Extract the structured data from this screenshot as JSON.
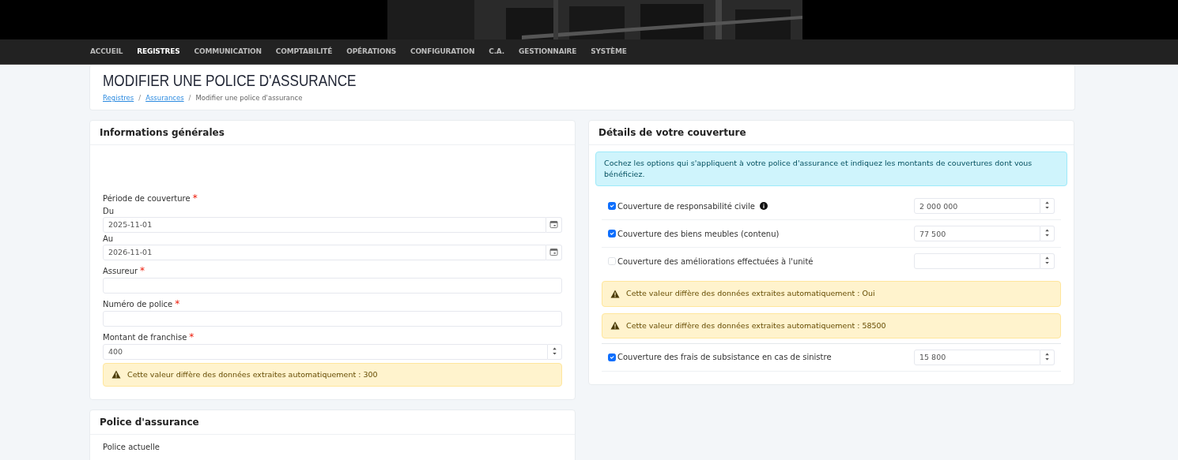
{
  "nav": [
    {
      "label": "ACCUEIL",
      "selected": false
    },
    {
      "label": "REGISTRES",
      "selected": true
    },
    {
      "label": "COMMUNICATION",
      "selected": false
    },
    {
      "label": "COMPTABILITÉ",
      "selected": false
    },
    {
      "label": "OPÉRATIONS",
      "selected": false
    },
    {
      "label": "CONFIGURATION",
      "selected": false
    },
    {
      "label": "C.A.",
      "selected": false
    },
    {
      "label": "GESTIONNAIRE",
      "selected": false
    },
    {
      "label": "SYSTÈME",
      "selected": false
    }
  ],
  "page": {
    "title": "MODIFIER UNE POLICE D'ASSURANCE",
    "separator": "/",
    "breadcrumb": [
      {
        "label": "Registres",
        "link": true
      },
      {
        "label": "Assurances",
        "link": true
      },
      {
        "label": "Modifier une police d'assurance",
        "link": false
      }
    ]
  },
  "general": {
    "title": "Informations générales",
    "fields": [
      {
        "kind": "group",
        "label": "Période de couverture",
        "asterisk": "*"
      },
      {
        "kind": "date",
        "label": "Du",
        "value": "2025-11-01"
      },
      {
        "kind": "date",
        "label": "Au",
        "value": "2026-11-01"
      },
      {
        "kind": "text",
        "label": "Assureur",
        "asterisk": "*"
      },
      {
        "kind": "text",
        "label": "Numéro de police",
        "asterisk": "*"
      },
      {
        "kind": "number",
        "label": "Montant de franchise",
        "asterisk": "*",
        "value": "400"
      },
      {
        "kind": "warning",
        "text": "Cette valeur diffère des données extraites automatiquement : 300"
      }
    ]
  },
  "policy": {
    "title": "Police d'assurance",
    "fields": [
      {
        "kind": "group",
        "label": "Police actuelle"
      }
    ]
  },
  "coverage": {
    "title": "Détails de votre couverture",
    "info": "Cochez les options qui s'appliquent à votre police d'assurance et indiquez les montants de couvertures dont vous bénéficiez.",
    "rows": [
      {
        "kind": "option",
        "label": "Couverture de responsabilité civile",
        "checked": true,
        "info_icon": true,
        "value": "2 000 000"
      },
      {
        "kind": "option",
        "label": "Couverture des biens meubles (contenu)",
        "checked": true,
        "info_icon": false,
        "value": "77 500"
      },
      {
        "kind": "option",
        "label": "Couverture des améliorations effectuées à l'unité",
        "checked": false,
        "info_icon": false
      },
      {
        "kind": "warning",
        "text": "Cette valeur diffère des données extraites automatiquement : Oui"
      },
      {
        "kind": "warning",
        "text": "Cette valeur diffère des données extraites automatiquement : 58500"
      },
      {
        "kind": "option",
        "label": "Couverture des frais de subsistance en cas de sinistre",
        "checked": true,
        "info_icon": false,
        "value": "15 800"
      }
    ]
  }
}
